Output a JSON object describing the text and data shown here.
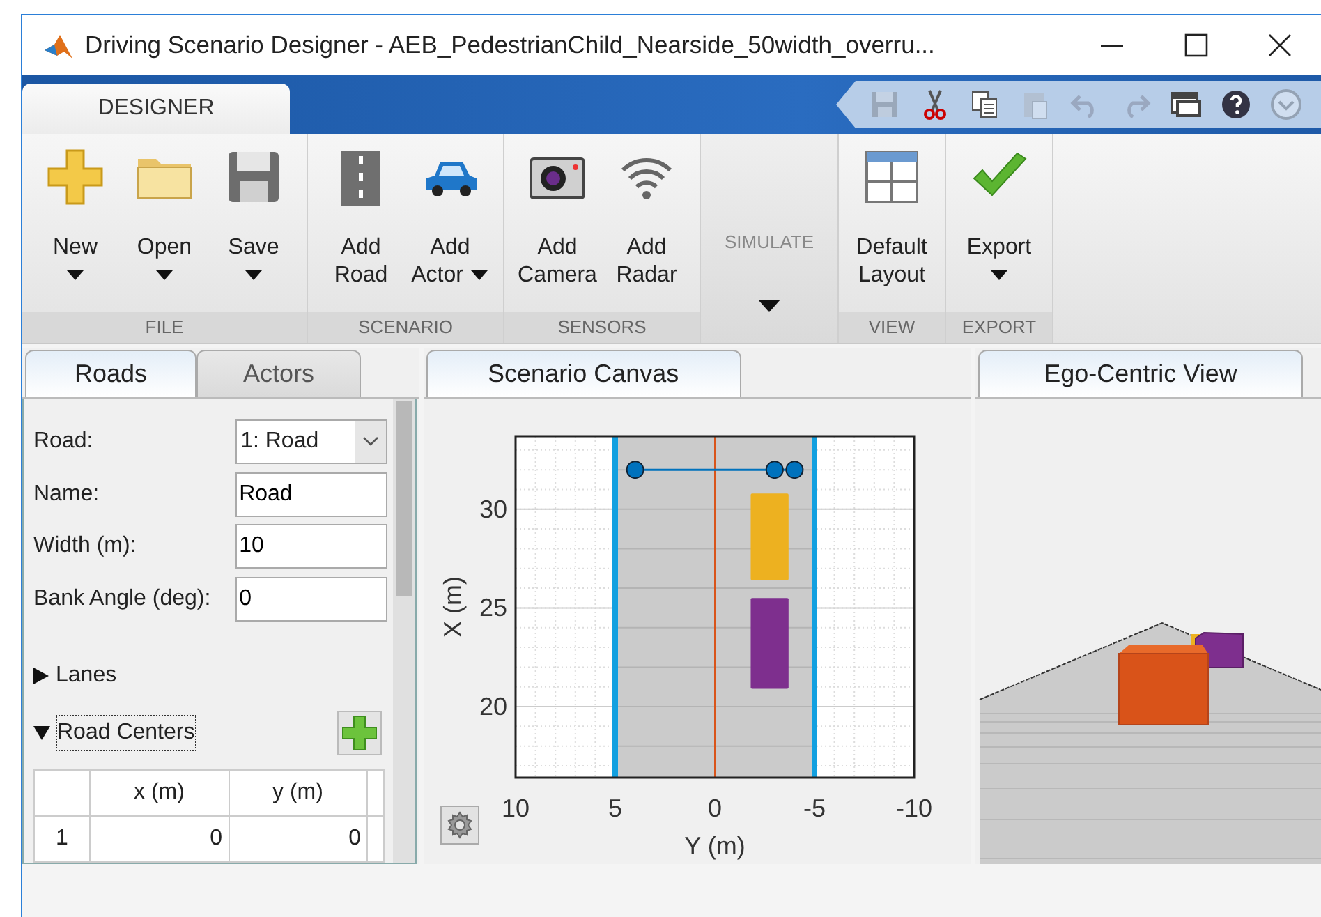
{
  "window": {
    "title": "Driving Scenario Designer - AEB_PedestrianChild_Nearside_50width_overru..."
  },
  "ribbon": {
    "tabs": [
      {
        "label": "DESIGNER",
        "selected": true
      }
    ],
    "quick_access": [
      {
        "disabled": true
      },
      {
        "disabled": false
      },
      {
        "disabled": false
      },
      {
        "disabled": true
      },
      {
        "disabled": true
      },
      {
        "disabled": true
      },
      {
        "disabled": false
      },
      {
        "disabled": false
      },
      {
        "disabled": true
      }
    ],
    "groups": [
      {
        "label": "FILE",
        "kind": "buttons",
        "buttons": [
          {
            "label": "New",
            "kind": "dropdown"
          },
          {
            "label": "Open",
            "kind": "dropdown"
          },
          {
            "label": "Save",
            "kind": "dropdown"
          }
        ]
      },
      {
        "label": "SCENARIO",
        "kind": "buttons",
        "buttons": [
          {
            "label": "Add Road",
            "kind": "push"
          },
          {
            "label": "Add Actor",
            "kind": "inlinedropdown"
          }
        ]
      },
      {
        "label": "SENSORS",
        "kind": "buttons",
        "buttons": [
          {
            "label": "Add Camera",
            "kind": "push"
          },
          {
            "label": "Add Radar",
            "kind": "push"
          }
        ]
      },
      {
        "label": "SIMULATE",
        "kind": "menu",
        "disabled": true
      },
      {
        "label": "VIEW",
        "kind": "buttons",
        "buttons": [
          {
            "label": "Default Layout",
            "kind": "push"
          }
        ]
      },
      {
        "label": "EXPORT",
        "kind": "buttons",
        "buttons": [
          {
            "label": "Export",
            "kind": "dropdown"
          }
        ]
      }
    ]
  },
  "left_panel": {
    "tabs": [
      {
        "label": "Roads",
        "selected": true
      },
      {
        "label": "Actors",
        "selected": false
      }
    ],
    "fields": [
      {
        "label": "Road:",
        "value": "1: Road",
        "kind": "select"
      },
      {
        "label": "Name:",
        "value": "Road",
        "kind": "text"
      },
      {
        "label": "Width (m):",
        "value": "10",
        "kind": "text"
      },
      {
        "label": "Bank Angle (deg):",
        "value": "0",
        "kind": "text"
      }
    ],
    "sections": [
      {
        "label": "Lanes",
        "expanded": false,
        "focused": false
      },
      {
        "label": "Road Centers",
        "expanded": true,
        "focused": true
      }
    ],
    "table": {
      "columns": [
        "x (m)",
        "y (m)"
      ],
      "rows": [
        {
          "index": "1",
          "cells": [
            "0",
            "0"
          ]
        }
      ]
    }
  },
  "scenario_canvas": {
    "tab": "Scenario Canvas",
    "chart_data": {
      "type": "line",
      "grid": true,
      "bands": [
        {
          "axis": "x",
          "from": 5,
          "to": -5,
          "color": "#cbcbcb"
        }
      ],
      "ref_lines": [
        {
          "axis": "y",
          "value": 18,
          "color": "#b4b4b4"
        },
        {
          "axis": "y",
          "value": 20,
          "color": "#b4b4b4"
        },
        {
          "axis": "y",
          "value": 22,
          "color": "#b4b4b4"
        },
        {
          "axis": "y",
          "value": 24,
          "color": "#b4b4b4"
        },
        {
          "axis": "y",
          "value": 26,
          "color": "#b4b4b4"
        },
        {
          "axis": "y",
          "value": 28,
          "color": "#b4b4b4"
        },
        {
          "axis": "y",
          "value": 30,
          "color": "#b4b4b4"
        },
        {
          "axis": "y",
          "value": 32,
          "color": "#b4b4b4"
        },
        {
          "axis": "x",
          "value": 0,
          "color": "#d9541a"
        },
        {
          "axis": "x",
          "value": 5,
          "color": "#12a0e0"
        },
        {
          "axis": "x",
          "value": -5,
          "color": "#12a0e0"
        }
      ],
      "xlabel": "Y (m)",
      "ylabel": "X (m)",
      "xlim": [
        10,
        -10
      ],
      "ylim": [
        16.4,
        33.7
      ],
      "xticks": [
        {
          "value": 10,
          "label": "10"
        },
        {
          "value": 5,
          "label": "5"
        },
        {
          "value": 0,
          "label": "0"
        },
        {
          "value": -5,
          "label": "-5"
        },
        {
          "value": -10,
          "label": "-10"
        }
      ],
      "yticks": [
        {
          "value": 20,
          "label": "20"
        },
        {
          "value": 25,
          "label": "25"
        },
        {
          "value": 30,
          "label": "30"
        }
      ],
      "series": [
        {
          "color": "#0072bd",
          "marker": "o",
          "x": [
            4,
            -3,
            -4
          ],
          "values": [
            32,
            32,
            32
          ]
        }
      ]
    }
  },
  "ego_view": {
    "tab": "Ego-Centric View"
  }
}
